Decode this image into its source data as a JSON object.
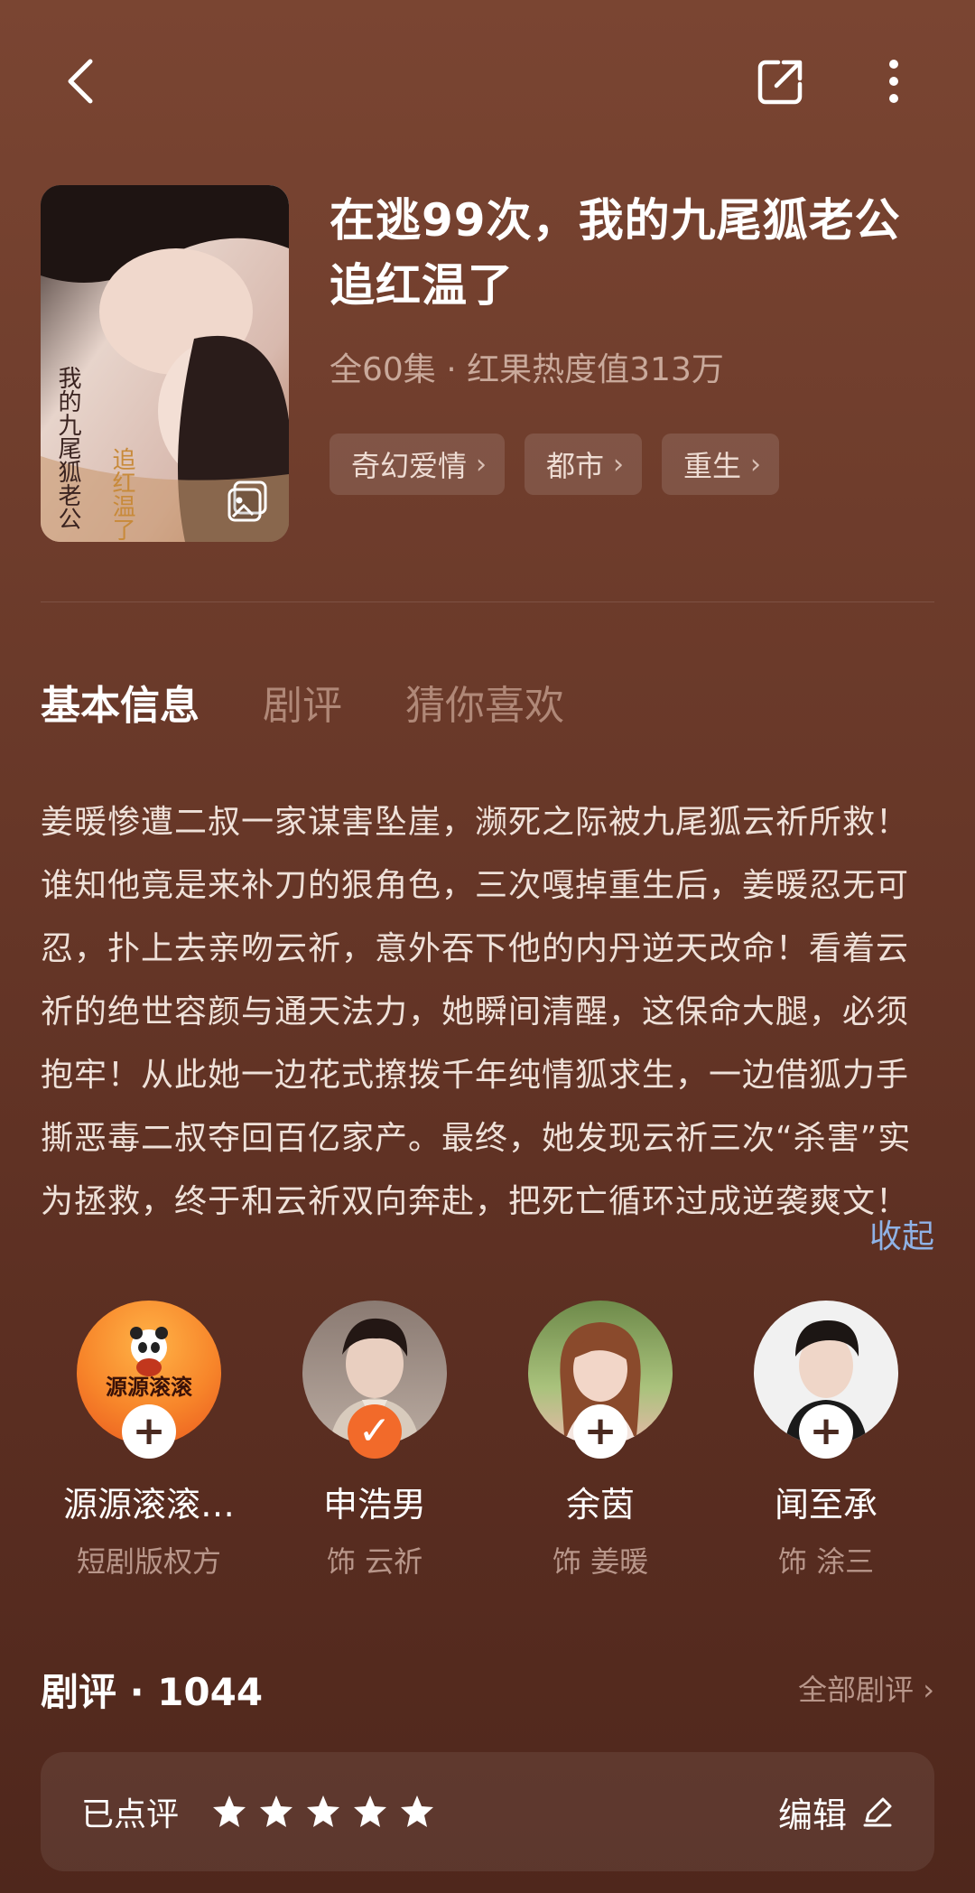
{
  "header": {
    "back_icon": "back-arrow-icon",
    "share_icon": "share-icon",
    "more_icon": "more-vertical-icon"
  },
  "drama": {
    "title": "在逃99次，我的九尾狐老公追红温了",
    "meta": "全60集 · 红果热度值313万",
    "tags": [
      {
        "label": "奇幻爱情"
      },
      {
        "label": "都市"
      },
      {
        "label": "重生"
      }
    ]
  },
  "tabs": [
    {
      "label": "基本信息",
      "active": true
    },
    {
      "label": "剧评",
      "active": false
    },
    {
      "label": "猜你喜欢",
      "active": false
    }
  ],
  "synopsis": {
    "text": "姜暖惨遭二叔一家谋害坠崖，濒死之际被九尾狐云祈所救！谁知他竟是来补刀的狠角色，三次嘎掉重生后，姜暖忍无可忍，扑上去亲吻云祈，意外吞下他的内丹逆天改命！看着云祈的绝世容颜与通天法力，她瞬间清醒，这保命大腿，必须抱牢！从此她一边花式撩拨千年纯情狐求生，一边借狐力手撕恶毒二叔夺回百亿家产。最终，她发现云祈三次“杀害”实为拯救，终于和云祈双向奔赴，把死亡循环过成逆袭爽文！",
    "collapse_label": "收起"
  },
  "cast": [
    {
      "name": "源源滚滚…",
      "role": "短剧版权方",
      "followed": false,
      "follow_icon": "+",
      "logo_text": "源源滚滚"
    },
    {
      "name": "申浩男",
      "role": "饰 云祈",
      "followed": true,
      "follow_icon": "✓"
    },
    {
      "name": "余茵",
      "role": "饰 姜暖",
      "followed": false,
      "follow_icon": "+"
    },
    {
      "name": "闻至承",
      "role": "饰 涂三",
      "followed": false,
      "follow_icon": "+"
    }
  ],
  "reviews": {
    "header": "剧评 · 1044",
    "all_label": "全部剧评 ›",
    "rated_label": "已点评",
    "rating": 5,
    "edit_label": "编辑"
  },
  "colors": {
    "accent_orange": "#f26a2a",
    "link_blue": "#8fb2e6"
  }
}
